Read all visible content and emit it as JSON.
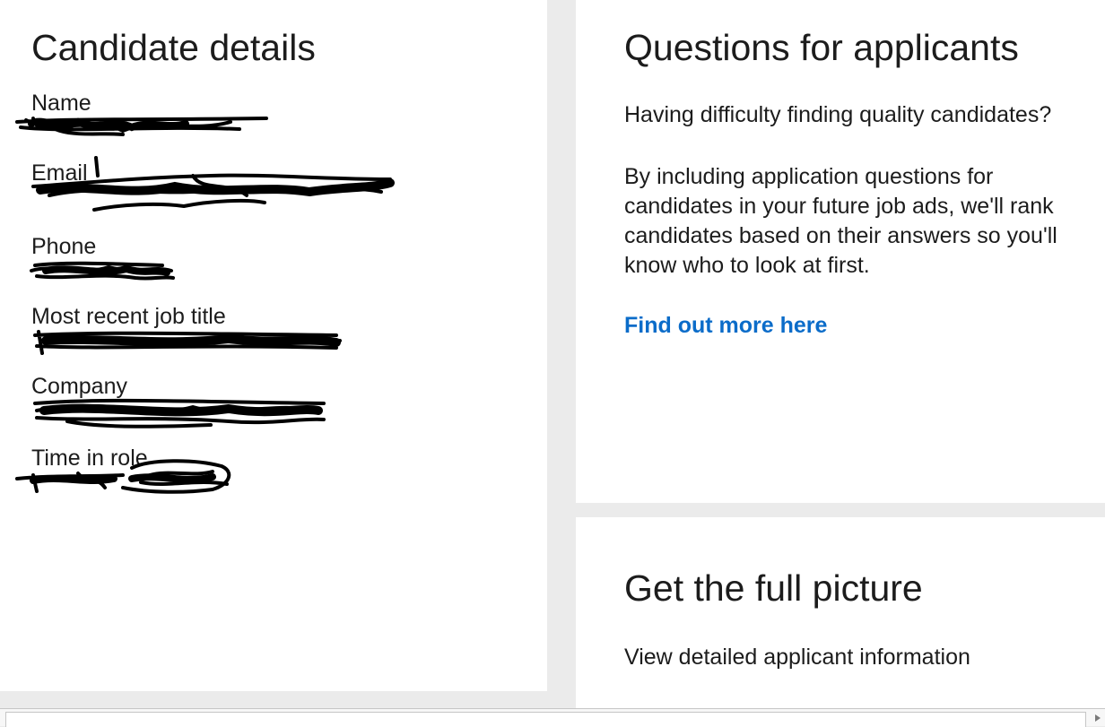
{
  "candidate": {
    "title": "Candidate details",
    "fields": [
      {
        "label": "Name",
        "value": ""
      },
      {
        "label": "Email",
        "value": ""
      },
      {
        "label": "Phone",
        "value": ""
      },
      {
        "label": "Most recent job title",
        "value": ""
      },
      {
        "label": "Company",
        "value": ""
      },
      {
        "label": "Time in role",
        "value": ""
      }
    ]
  },
  "questions": {
    "title": "Questions for applicants",
    "para1": "Having difficulty finding quality candidates?",
    "para2": "By including application questions for candidates in your future job ads, we'll rank candidates based on their answers so you'll know who to look at first.",
    "link": "Find out more here"
  },
  "full_picture": {
    "title": "Get the full picture",
    "subtitle": "View detailed applicant information"
  },
  "colors": {
    "link": "#0b6cc9",
    "text": "#1c1c1c",
    "background": "#ebebeb"
  }
}
